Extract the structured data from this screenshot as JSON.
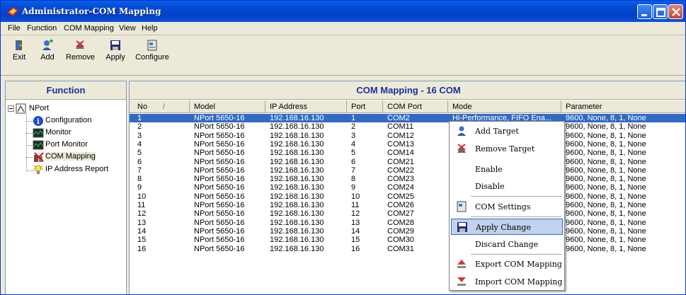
{
  "window": {
    "title": "Administrator-COM Mapping"
  },
  "menu": [
    "File",
    "Function",
    "COM Mapping",
    "View",
    "Help"
  ],
  "toolbar": {
    "exit": "Exit",
    "add": "Add",
    "remove": "Remove",
    "apply": "Apply",
    "configure": "Configure"
  },
  "left": {
    "header": "Function",
    "root": "NPort",
    "items": [
      "Configuration",
      "Monitor",
      "Port Monitor",
      "COM Mapping",
      "IP Address Report"
    ]
  },
  "right": {
    "header": "COM Mapping - 16 COM",
    "columns": [
      "No",
      "Model",
      "IP Address",
      "Port",
      "COM Port",
      "Mode",
      "Parameter"
    ],
    "rows": [
      {
        "no": "1",
        "model": "NPort 5650-16",
        "ip": "192.168.16.130",
        "port": "1",
        "com": "COM2",
        "mode": "Hi-Performance, FIFO Ena...",
        "param": "9600, None, 8, 1, None"
      },
      {
        "no": "2",
        "model": "NPort 5650-16",
        "ip": "192.168.16.130",
        "port": "2",
        "com": "COM11",
        "mode": "",
        "param": "9600, None, 8, 1, None"
      },
      {
        "no": "3",
        "model": "NPort 5650-16",
        "ip": "192.168.16.130",
        "port": "3",
        "com": "COM12",
        "mode": "",
        "param": "9600, None, 8, 1, None"
      },
      {
        "no": "4",
        "model": "NPort 5650-16",
        "ip": "192.168.16.130",
        "port": "4",
        "com": "COM13",
        "mode": "",
        "param": "9600, None, 8, 1, None"
      },
      {
        "no": "5",
        "model": "NPort 5650-16",
        "ip": "192.168.16.130",
        "port": "5",
        "com": "COM14",
        "mode": "",
        "param": "9600, None, 8, 1, None"
      },
      {
        "no": "6",
        "model": "NPort 5650-16",
        "ip": "192.168.16.130",
        "port": "6",
        "com": "COM21",
        "mode": "",
        "param": "9600, None, 8, 1, None"
      },
      {
        "no": "7",
        "model": "NPort 5650-16",
        "ip": "192.168.16.130",
        "port": "7",
        "com": "COM22",
        "mode": "",
        "param": "9600, None, 8, 1, None"
      },
      {
        "no": "8",
        "model": "NPort 5650-16",
        "ip": "192.168.16.130",
        "port": "8",
        "com": "COM23",
        "mode": "",
        "param": "9600, None, 8, 1, None"
      },
      {
        "no": "9",
        "model": "NPort 5650-16",
        "ip": "192.168.16.130",
        "port": "9",
        "com": "COM24",
        "mode": "",
        "param": "9600, None, 8, 1, None"
      },
      {
        "no": "10",
        "model": "NPort 5650-16",
        "ip": "192.168.16.130",
        "port": "10",
        "com": "COM25",
        "mode": "",
        "param": "9600, None, 8, 1, None"
      },
      {
        "no": "11",
        "model": "NPort 5650-16",
        "ip": "192.168.16.130",
        "port": "11",
        "com": "COM26",
        "mode": "",
        "param": "9600, None, 8, 1, None"
      },
      {
        "no": "12",
        "model": "NPort 5650-16",
        "ip": "192.168.16.130",
        "port": "12",
        "com": "COM27",
        "mode": "",
        "param": "9600, None, 8, 1, None"
      },
      {
        "no": "13",
        "model": "NPort 5650-16",
        "ip": "192.168.16.130",
        "port": "13",
        "com": "COM28",
        "mode": "",
        "param": "9600, None, 8, 1, None"
      },
      {
        "no": "14",
        "model": "NPort 5650-16",
        "ip": "192.168.16.130",
        "port": "14",
        "com": "COM29",
        "mode": "",
        "param": "9600, None, 8, 1, None"
      },
      {
        "no": "15",
        "model": "NPort 5650-16",
        "ip": "192.168.16.130",
        "port": "15",
        "com": "COM30",
        "mode": "",
        "param": "9600, None, 8, 1, None"
      },
      {
        "no": "16",
        "model": "NPort 5650-16",
        "ip": "192.168.16.130",
        "port": "16",
        "com": "COM31",
        "mode": "",
        "param": "9600, None, 8, 1, None"
      }
    ]
  },
  "context_menu": [
    "Add Target",
    "Remove Target",
    "Enable",
    "Disable",
    "COM Settings",
    "Apply Change",
    "Discard Change",
    "Export COM Mapping",
    "Import COM Mapping"
  ],
  "icons": [
    "moxa-app-icon",
    "minimize-icon",
    "maximize-icon",
    "close-icon",
    "exit-icon",
    "add-icon",
    "remove-icon",
    "apply-icon",
    "configure-icon",
    "nport-icon",
    "info-icon",
    "monitor-icon",
    "port-monitor-icon",
    "com-mapping-icon",
    "ip-report-icon"
  ]
}
